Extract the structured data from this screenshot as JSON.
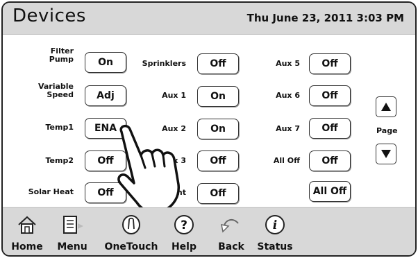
{
  "header": {
    "title": "Devices",
    "datetime": "Thu June 23, 2011  3:03 PM"
  },
  "devices": {
    "filter_pump": {
      "label": "Filter Pump",
      "value": "On"
    },
    "variable_speed": {
      "label": "Variable Speed",
      "value": "Adj"
    },
    "temp1": {
      "label": "Temp1",
      "value": "ENA"
    },
    "temp2": {
      "label": "Temp2",
      "value": "Off"
    },
    "solar_heat": {
      "label": "Solar Heat",
      "value": "Off"
    },
    "sprinklers": {
      "label": "Sprinklers",
      "value": "Off"
    },
    "aux1": {
      "label": "Aux 1",
      "value": "On"
    },
    "aux2": {
      "label": "Aux 2",
      "value": "On"
    },
    "aux3": {
      "label": "Aux 3",
      "value": "Off"
    },
    "aux4": {
      "label": "nt",
      "value": "Off"
    },
    "aux5": {
      "label": "Aux 5",
      "value": "Off"
    },
    "aux6": {
      "label": "Aux 6",
      "value": "Off"
    },
    "aux7": {
      "label": "Aux 7",
      "value": "Off"
    },
    "all_off": {
      "label": "All Off",
      "value": "Off"
    },
    "all_off_button": "All Off"
  },
  "pager": {
    "label": "Page",
    "up_icon": "triangle-up-icon",
    "down_icon": "triangle-down-icon"
  },
  "nav": [
    {
      "label": "Home",
      "icon": "home-icon"
    },
    {
      "label": "Menu",
      "icon": "menu-icon"
    },
    {
      "label": "OneTouch",
      "icon": "onetouch-icon"
    },
    {
      "label": "Help",
      "icon": "help-icon"
    },
    {
      "label": "Back",
      "icon": "back-icon"
    },
    {
      "label": "Status",
      "icon": "status-icon"
    }
  ],
  "colors": {
    "header_bg": "#d8d8d8",
    "footer_bg": "#d8d8d8",
    "button_border": "#333333"
  }
}
